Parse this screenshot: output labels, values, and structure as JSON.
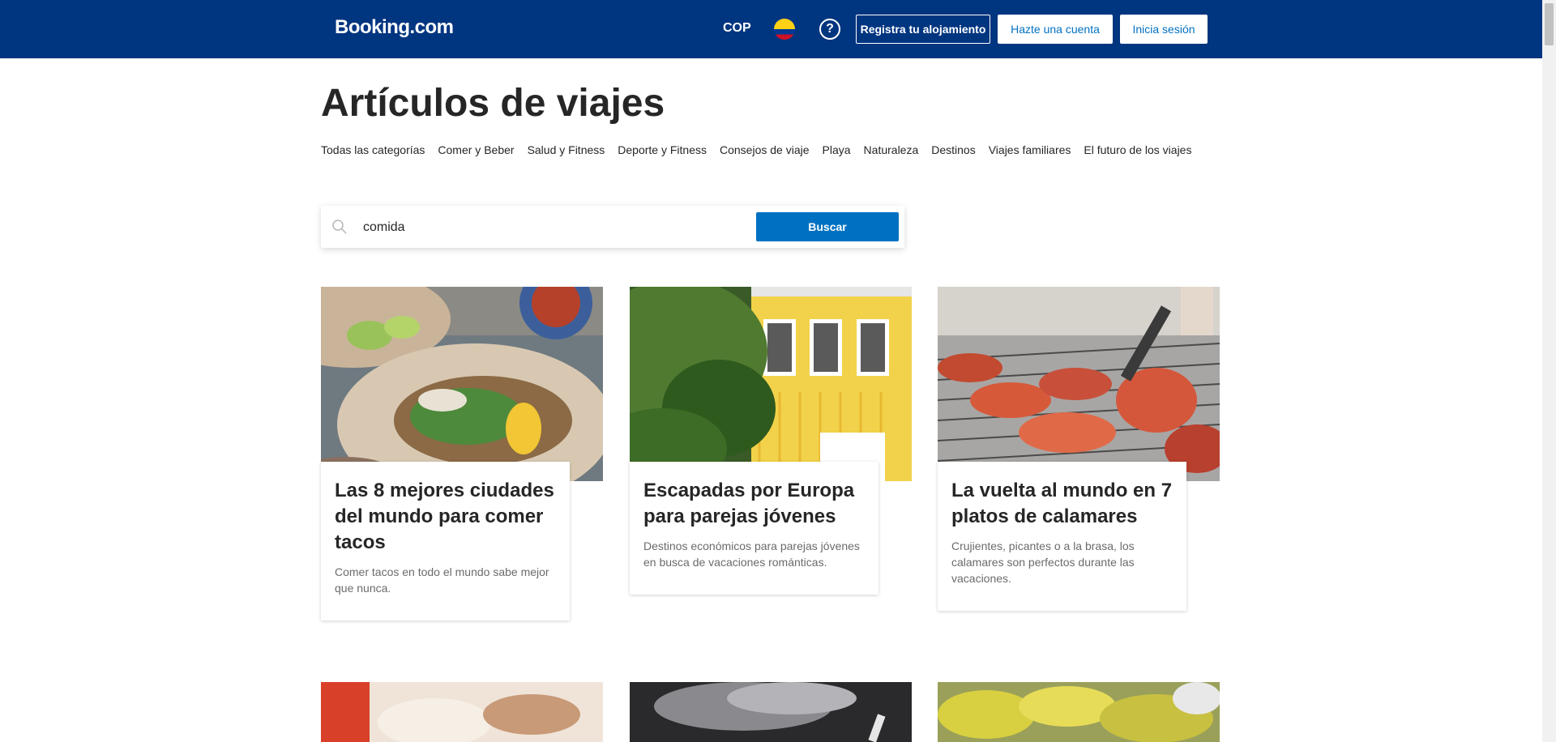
{
  "header": {
    "logo": "Booking.com",
    "currency": "COP",
    "flag_icon": "colombia-flag-icon",
    "help_icon": "question-circle-icon",
    "help_symbol": "?",
    "register_property": "Registra tu alojamiento",
    "create_account": "Hazte una cuenta",
    "sign_in": "Inicia sesión",
    "brand_color": "#003580"
  },
  "page": {
    "title": "Artículos de viajes"
  },
  "categories": [
    "Todas las categorías",
    "Comer y Beber",
    "Salud y Fitness",
    "Deporte y Fitness",
    "Consejos de viaje",
    "Playa",
    "Naturaleza",
    "Destinos",
    "Viajes familiares",
    "El futuro de los viajes"
  ],
  "search": {
    "value": "comida",
    "button": "Buscar",
    "icon": "search-icon",
    "accent_color": "#0071c2"
  },
  "articles": [
    {
      "title": "Las 8 mejores ciudades del mundo para comer tacos",
      "description": "Comer tacos en todo el mundo sabe mejor que nunca.",
      "image": "tacos-photo"
    },
    {
      "title": "Escapadas por Europa para parejas jóvenes",
      "description": "Destinos económicos para parejas jóvenes en busca de vacaciones románticas.",
      "image": "yellow-house-photo"
    },
    {
      "title": "La vuelta al mundo en 7 platos de calamares",
      "description": "Crujientes, picantes o a la brasa, los calamares son perfectos durante las vacaciones.",
      "image": "grilled-squid-photo"
    }
  ],
  "more_articles": [
    {
      "image": "restaurant-photo"
    },
    {
      "image": "smoke-grill-photo"
    },
    {
      "image": "produce-market-photo"
    }
  ]
}
